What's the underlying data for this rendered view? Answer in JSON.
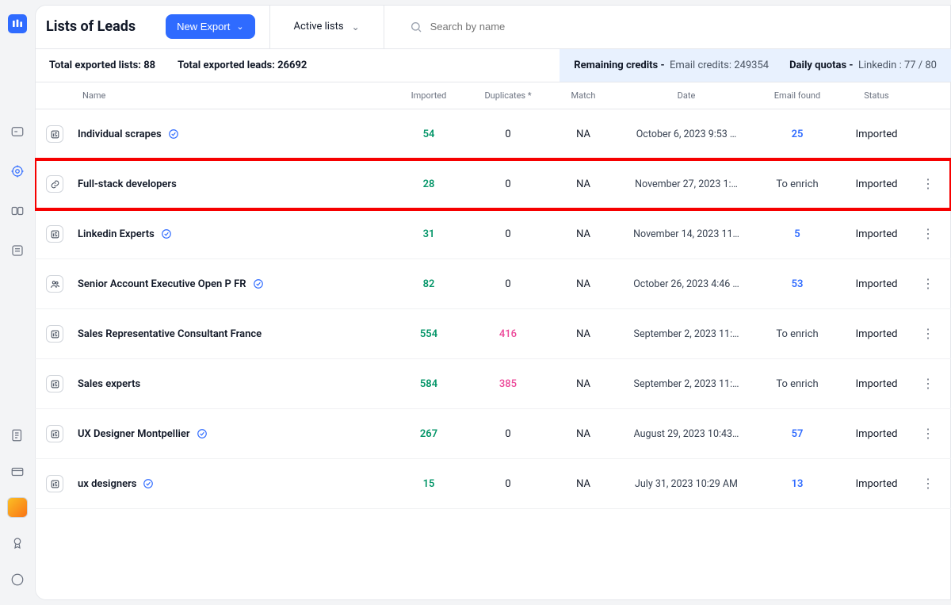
{
  "header": {
    "title": "Lists of Leads",
    "new_export_label": "New Export",
    "active_lists_label": "Active lists",
    "search_placeholder": "Search by name"
  },
  "stats": {
    "total_lists_label": "Total exported lists:",
    "total_lists_value": "88",
    "total_leads_label": "Total exported leads:",
    "total_leads_value": "26692",
    "remaining_label": "Remaining credits -",
    "email_credits_label": "Email credits:",
    "email_credits_value": "249354",
    "daily_quotas_label": "Daily quotas -",
    "linkedin_quota_label": "Linkedin :",
    "linkedin_quota_value": "77 / 80"
  },
  "columns": {
    "name": "Name",
    "imported": "Imported",
    "duplicates": "Duplicates *",
    "match": "Match",
    "date": "Date",
    "email_found": "Email found",
    "status": "Status"
  },
  "rows": [
    {
      "src": "in",
      "name": "Individual scrapes",
      "verified": true,
      "imported": "54",
      "dup": "0",
      "dup_style": "zero",
      "match": "NA",
      "date": "October 6, 2023 9:53 …",
      "ef": "25",
      "ef_style": "blue",
      "status": "Imported",
      "kebab": false,
      "highlight": false
    },
    {
      "src": "link",
      "name": "Full-stack developers",
      "verified": false,
      "imported": "28",
      "dup": "0",
      "dup_style": "zero",
      "match": "NA",
      "date": "November 27, 2023 1:…",
      "ef": "To enrich",
      "ef_style": "gray",
      "status": "Imported",
      "kebab": true,
      "highlight": true
    },
    {
      "src": "in",
      "name": "Linkedin Experts",
      "verified": true,
      "imported": "31",
      "dup": "0",
      "dup_style": "zero",
      "match": "NA",
      "date": "November 14, 2023 11…",
      "ef": "5",
      "ef_style": "blue",
      "status": "Imported",
      "kebab": true,
      "highlight": false
    },
    {
      "src": "people",
      "name": "Senior Account Executive Open P FR",
      "verified": true,
      "imported": "82",
      "dup": "0",
      "dup_style": "zero",
      "match": "NA",
      "date": "October 26, 2023 4:46 …",
      "ef": "53",
      "ef_style": "blue",
      "status": "Imported",
      "kebab": true,
      "highlight": false
    },
    {
      "src": "in",
      "name": "Sales Representative Consultant France",
      "verified": false,
      "imported": "554",
      "dup": "416",
      "dup_style": "pink",
      "match": "NA",
      "date": "September 2, 2023 11:…",
      "ef": "To enrich",
      "ef_style": "gray",
      "status": "Imported",
      "kebab": true,
      "highlight": false
    },
    {
      "src": "in",
      "name": "Sales experts",
      "verified": false,
      "imported": "584",
      "dup": "385",
      "dup_style": "pink",
      "match": "NA",
      "date": "September 2, 2023 11:…",
      "ef": "To enrich",
      "ef_style": "gray",
      "status": "Imported",
      "kebab": true,
      "highlight": false
    },
    {
      "src": "in",
      "name": "UX Designer Montpellier",
      "verified": true,
      "imported": "267",
      "dup": "0",
      "dup_style": "zero",
      "match": "NA",
      "date": "August 29, 2023 10:43…",
      "ef": "57",
      "ef_style": "blue",
      "status": "Imported",
      "kebab": true,
      "highlight": false
    },
    {
      "src": "in",
      "name": "ux designers",
      "verified": true,
      "imported": "15",
      "dup": "0",
      "dup_style": "zero",
      "match": "NA",
      "date": "July 31, 2023 10:29 AM",
      "ef": "13",
      "ef_style": "blue",
      "status": "Imported",
      "kebab": true,
      "highlight": false
    }
  ]
}
